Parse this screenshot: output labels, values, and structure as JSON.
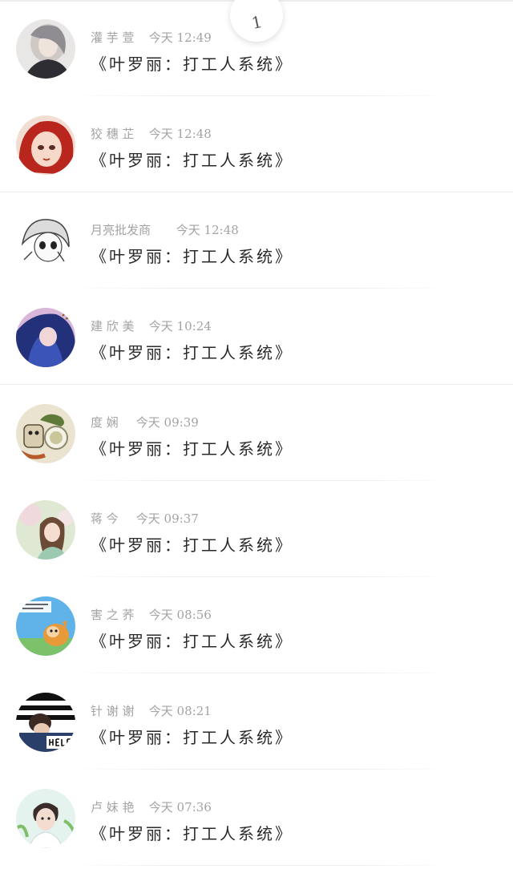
{
  "float_button": {
    "label": "1"
  },
  "comments": [
    {
      "name": "灌 芋 萱",
      "time": "今天 12:49",
      "text": "《叶罗丽：打工人系统》",
      "avatar_color": "#6f6f78"
    },
    {
      "name": "狡 穗 芷",
      "time": "今天 12:48",
      "text": "《叶罗丽：打工人系统》",
      "avatar_color": "#c0392b"
    },
    {
      "name": "月亮批发商",
      "time": "今天 12:48",
      "text": "《叶罗丽：打工人系统》",
      "avatar_color": "#e8e8e8"
    },
    {
      "name": "建 欣 美",
      "time": "今天 10:24",
      "text": "《叶罗丽：打工人系统》",
      "avatar_color": "#2b3a8c"
    },
    {
      "name": "度 娴",
      "time": "今天 09:39",
      "text": "《叶罗丽：打工人系统》",
      "avatar_color": "#7a8a5a"
    },
    {
      "name": "蒋 今",
      "time": "今天 09:37",
      "text": "《叶罗丽：打工人系统》",
      "avatar_color": "#b7c9a4"
    },
    {
      "name": "害 之 荞",
      "time": "今天 08:56",
      "text": "《叶罗丽：打工人系统》",
      "avatar_color": "#4aa3e0"
    },
    {
      "name": "针 谢 谢",
      "time": "今天 08:21",
      "text": "《叶罗丽：打工人系统》",
      "avatar_color": "#1c2b4a"
    },
    {
      "name": "卢 妹 艳",
      "time": "今天 07:36",
      "text": "《叶罗丽：打工人系统》",
      "avatar_color": "#9fd1c4"
    }
  ]
}
